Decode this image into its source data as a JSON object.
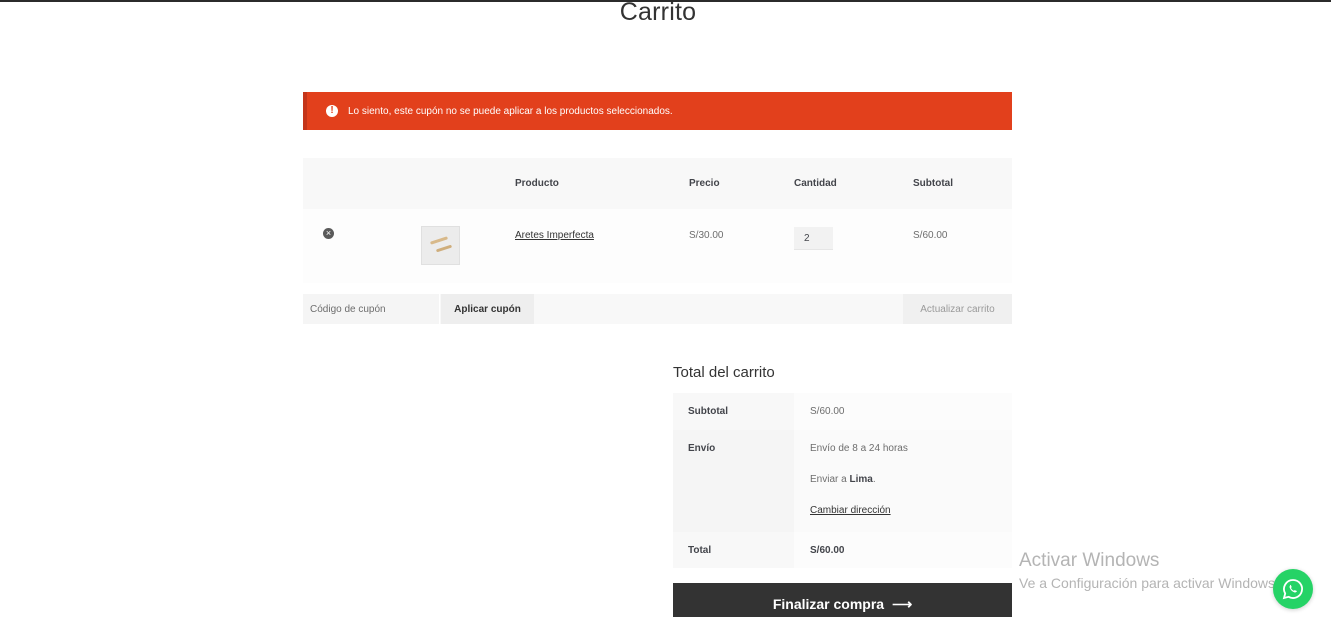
{
  "page": {
    "title": "Carrito"
  },
  "notice": {
    "icon": "error-icon",
    "color": "#e2401c",
    "message": "Lo siento, este cupón no se puede aplicar a los productos seleccionados."
  },
  "cart": {
    "headers": {
      "product": "Producto",
      "price": "Precio",
      "quantity": "Cantidad",
      "subtotal": "Subtotal"
    },
    "items": [
      {
        "name": "Aretes Imperfecta",
        "price": "S/30.00",
        "quantity": "2",
        "subtotal": "S/60.00"
      }
    ],
    "coupon_placeholder": "Código de cupón",
    "apply_coupon_label": "Aplicar cupón",
    "update_cart_label": "Actualizar carrito"
  },
  "totals": {
    "title": "Total del carrito",
    "subtotal_label": "Subtotal",
    "subtotal_value": "S/60.00",
    "shipping_label": "Envío",
    "shipping_method": "Envío de 8 a 24 horas",
    "ship_to_prefix": "Enviar a",
    "ship_to_city": "Lima",
    "ship_to_suffix": ".",
    "change_address": "Cambiar dirección",
    "total_label": "Total",
    "total_value": "S/60.00",
    "checkout_label": "Finalizar compra",
    "checkout_arrow": "⟶"
  },
  "watermark": {
    "line1": "Activar Windows",
    "line2": "Ve a Configuración para activar Windows."
  },
  "whatsapp": {
    "icon": "whatsapp-icon",
    "color": "#25d366"
  }
}
